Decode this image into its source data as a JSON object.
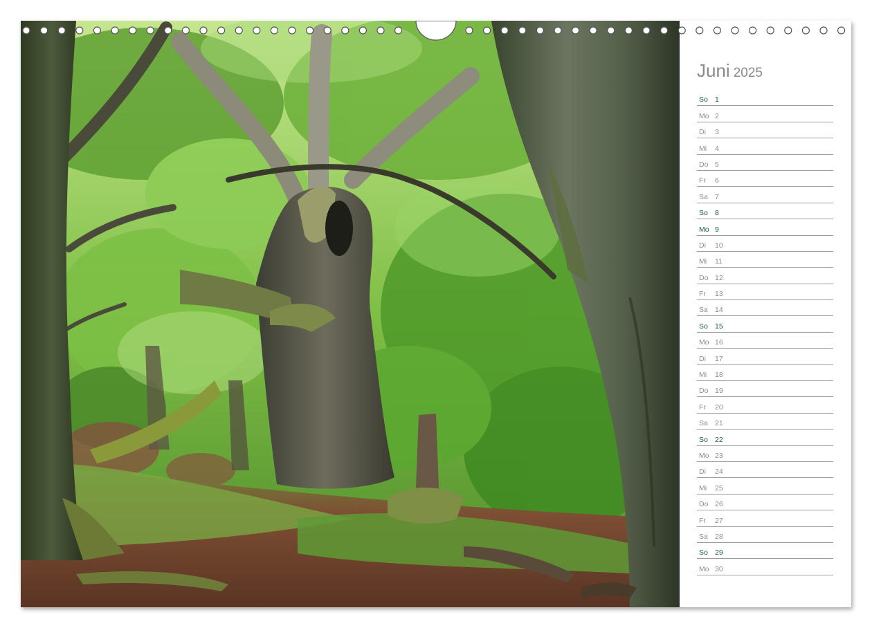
{
  "calendar": {
    "month": "Juni",
    "year": "2025",
    "days": [
      {
        "name": "So",
        "num": "1",
        "highlight": true
      },
      {
        "name": "Mo",
        "num": "2",
        "highlight": false
      },
      {
        "name": "Di",
        "num": "3",
        "highlight": false
      },
      {
        "name": "Mi",
        "num": "4",
        "highlight": false
      },
      {
        "name": "Do",
        "num": "5",
        "highlight": false
      },
      {
        "name": "Fr",
        "num": "6",
        "highlight": false
      },
      {
        "name": "Sa",
        "num": "7",
        "highlight": false
      },
      {
        "name": "So",
        "num": "8",
        "highlight": true
      },
      {
        "name": "Mo",
        "num": "9",
        "highlight": true
      },
      {
        "name": "Di",
        "num": "10",
        "highlight": false
      },
      {
        "name": "Mi",
        "num": "11",
        "highlight": false
      },
      {
        "name": "Do",
        "num": "12",
        "highlight": false
      },
      {
        "name": "Fr",
        "num": "13",
        "highlight": false
      },
      {
        "name": "Sa",
        "num": "14",
        "highlight": false
      },
      {
        "name": "So",
        "num": "15",
        "highlight": true
      },
      {
        "name": "Mo",
        "num": "16",
        "highlight": false
      },
      {
        "name": "Di",
        "num": "17",
        "highlight": false
      },
      {
        "name": "Mi",
        "num": "18",
        "highlight": false
      },
      {
        "name": "Do",
        "num": "19",
        "highlight": false
      },
      {
        "name": "Fr",
        "num": "20",
        "highlight": false
      },
      {
        "name": "Sa",
        "num": "21",
        "highlight": false
      },
      {
        "name": "So",
        "num": "22",
        "highlight": true
      },
      {
        "name": "Mo",
        "num": "23",
        "highlight": false
      },
      {
        "name": "Di",
        "num": "24",
        "highlight": false
      },
      {
        "name": "Mi",
        "num": "25",
        "highlight": false
      },
      {
        "name": "Do",
        "num": "26",
        "highlight": false
      },
      {
        "name": "Fr",
        "num": "27",
        "highlight": false
      },
      {
        "name": "Sa",
        "num": "28",
        "highlight": false
      },
      {
        "name": "So",
        "num": "29",
        "highlight": true
      },
      {
        "name": "Mo",
        "num": "30",
        "highlight": false
      }
    ]
  },
  "colors": {
    "highlight_day": "#1f5f38",
    "normal_day": "#8c8c8c",
    "title": "#8a8a8a"
  }
}
